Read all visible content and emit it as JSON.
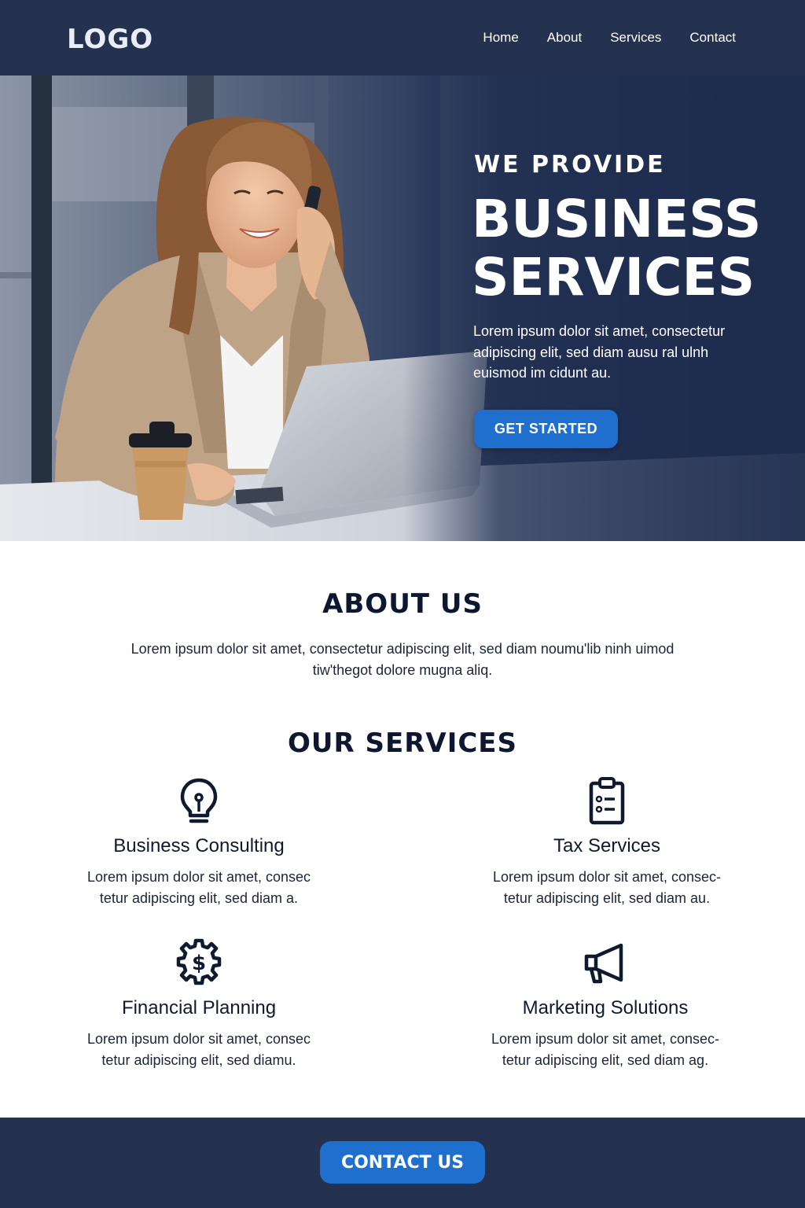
{
  "nav": {
    "logo": "LOGO",
    "links": [
      {
        "label": "Home"
      },
      {
        "label": "About"
      },
      {
        "label": "Services"
      },
      {
        "label": "Contact"
      }
    ]
  },
  "hero": {
    "kicker": "WE PROVIDE",
    "title_line1": "BUSINESS",
    "title_line2": "SERVICES",
    "text": "Lorem ipsum dolor sit amet, consectetur adipiscing elit, sed diam ausu ral ulnh euismod im cidunt au.",
    "cta_label": "GET STARTED",
    "image_subject": "woman on phone at laptop with coffee cup"
  },
  "about": {
    "heading": "ABOUT US",
    "text": "Lorem ipsum dolor sit amet, consectetur adipiscing elit, sed diam noumu'lib ninh uimod tiw'thegot dolore mugna aliq."
  },
  "services": {
    "heading": "OUR SERVICES",
    "items": [
      {
        "icon": "lightbulb-icon",
        "title": "Business Consulting",
        "desc": "Lorem ipsum dolor sit amet, consec tetur adipiscing elit, sed diam a."
      },
      {
        "icon": "clipboard-icon",
        "title": "Tax Services",
        "desc": "Lorem ipsum dolor sit amet, consec- tetur adipiscing elit, sed diam au."
      },
      {
        "icon": "gear-dollar-icon",
        "title": "Financial Planning",
        "desc": "Lorem ipsum dolor sit amet, consec tetur adipiscing elit, sed diamu."
      },
      {
        "icon": "megaphone-icon",
        "title": "Marketing Solutions",
        "desc": "Lorem ipsum dolor sit amet, consec- tetur adipiscing elit, sed diam ag."
      }
    ]
  },
  "footer": {
    "cta_label": "CONTACT US"
  },
  "colors": {
    "nav_bg": "#24324f",
    "accent": "#1f6fcf",
    "heading": "#0d1730"
  }
}
